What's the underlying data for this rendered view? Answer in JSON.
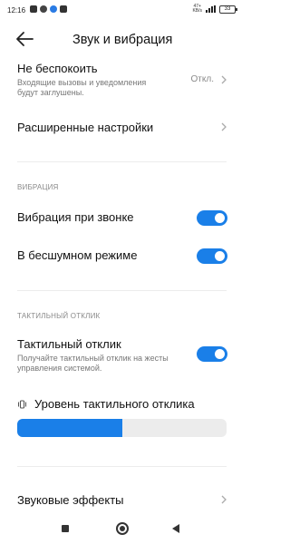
{
  "status_bar": {
    "time": "12:16",
    "net_speed_top": "47+",
    "net_speed_bottom": "KB/s",
    "battery": "33"
  },
  "header": {
    "title": "Звук и вибрация"
  },
  "dnd": {
    "title": "Не беспокоить",
    "subtitle": "Входящие вызовы и уведомления будут заглушены.",
    "value": "Откл."
  },
  "advanced": {
    "title": "Расширенные настройки"
  },
  "vibration_section": {
    "header": "ВИБРАЦИЯ",
    "on_call": {
      "label": "Вибрация при звонке",
      "enabled": true
    },
    "silent": {
      "label": "В бесшумном режиме",
      "enabled": true
    }
  },
  "haptic_section": {
    "header": "ТАКТИЛЬНЫЙ ОТКЛИК",
    "haptic": {
      "label": "Тактильный отклик",
      "subtitle": "Получайте тактильный отклик на жесты управления системой.",
      "enabled": true
    },
    "level": {
      "label": "Уровень тактильного отклика",
      "fraction": 0.5
    }
  },
  "sound_effects": {
    "title": "Звуковые эффекты"
  }
}
